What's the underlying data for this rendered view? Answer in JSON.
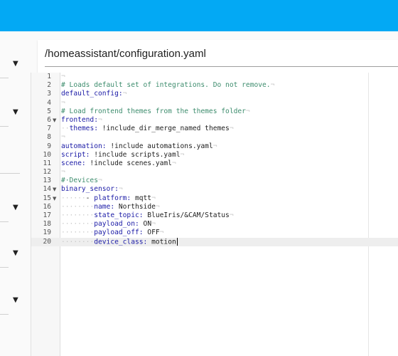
{
  "header": {
    "file_path": "/homeassistant/configuration.yaml"
  },
  "editor": {
    "lines": [
      {
        "n": "1",
        "fold": "",
        "parts": [
          {
            "t": "¬",
            "c": "ws"
          }
        ]
      },
      {
        "n": "2",
        "fold": "",
        "parts": [
          {
            "t": "# Loads default set of integrations. Do not remove.",
            "c": "comment"
          },
          {
            "t": "¬",
            "c": "ws"
          }
        ]
      },
      {
        "n": "3",
        "fold": "",
        "parts": [
          {
            "t": "default_config:",
            "c": "key"
          },
          {
            "t": "¬",
            "c": "ws"
          }
        ]
      },
      {
        "n": "4",
        "fold": "",
        "parts": [
          {
            "t": "¬",
            "c": "ws"
          }
        ]
      },
      {
        "n": "5",
        "fold": "",
        "parts": [
          {
            "t": "# Load frontend themes from the themes folder",
            "c": "comment"
          },
          {
            "t": "¬",
            "c": "ws"
          }
        ]
      },
      {
        "n": "6",
        "fold": "▼",
        "parts": [
          {
            "t": "frontend:",
            "c": "key"
          },
          {
            "t": "¬",
            "c": "ws"
          }
        ]
      },
      {
        "n": "7",
        "fold": "",
        "parts": [
          {
            "t": "··",
            "c": "ws"
          },
          {
            "t": "themes:",
            "c": "key"
          },
          {
            "t": " !include_dir_merge_named themes",
            "c": ""
          },
          {
            "t": "¬",
            "c": "ws"
          }
        ]
      },
      {
        "n": "8",
        "fold": "",
        "parts": [
          {
            "t": "¬",
            "c": "ws"
          }
        ]
      },
      {
        "n": "9",
        "fold": "",
        "parts": [
          {
            "t": "automation:",
            "c": "key"
          },
          {
            "t": " !include automations.yaml",
            "c": ""
          },
          {
            "t": "¬",
            "c": "ws"
          }
        ]
      },
      {
        "n": "10",
        "fold": "",
        "parts": [
          {
            "t": "script:",
            "c": "key"
          },
          {
            "t": " !include scripts.yaml",
            "c": ""
          },
          {
            "t": "¬",
            "c": "ws"
          }
        ]
      },
      {
        "n": "11",
        "fold": "",
        "parts": [
          {
            "t": "scene:",
            "c": "key"
          },
          {
            "t": " !include scenes.yaml",
            "c": ""
          },
          {
            "t": "¬",
            "c": "ws"
          }
        ]
      },
      {
        "n": "12",
        "fold": "",
        "parts": [
          {
            "t": "¬",
            "c": "ws"
          }
        ]
      },
      {
        "n": "13",
        "fold": "",
        "parts": [
          {
            "t": "#·Devices",
            "c": "comment"
          },
          {
            "t": "¬",
            "c": "ws"
          }
        ]
      },
      {
        "n": "14",
        "fold": "▼",
        "parts": [
          {
            "t": "binary_sensor:",
            "c": "key"
          },
          {
            "t": "¬",
            "c": "ws"
          }
        ]
      },
      {
        "n": "15",
        "fold": "▼",
        "parts": [
          {
            "t": "······",
            "c": "ws"
          },
          {
            "t": "- ",
            "c": ""
          },
          {
            "t": "platform:",
            "c": "key"
          },
          {
            "t": " mqtt",
            "c": ""
          },
          {
            "t": "¬",
            "c": "ws"
          }
        ]
      },
      {
        "n": "16",
        "fold": "",
        "parts": [
          {
            "t": "········",
            "c": "ws"
          },
          {
            "t": "name:",
            "c": "key"
          },
          {
            "t": " Northside",
            "c": ""
          },
          {
            "t": "¬",
            "c": "ws"
          }
        ]
      },
      {
        "n": "17",
        "fold": "",
        "parts": [
          {
            "t": "········",
            "c": "ws"
          },
          {
            "t": "state_topic:",
            "c": "key"
          },
          {
            "t": " BlueIris/&CAM/Status",
            "c": ""
          },
          {
            "t": "¬",
            "c": "ws"
          }
        ]
      },
      {
        "n": "18",
        "fold": "",
        "parts": [
          {
            "t": "········",
            "c": "ws"
          },
          {
            "t": "payload_on:",
            "c": "key"
          },
          {
            "t": " ON",
            "c": ""
          },
          {
            "t": "¬",
            "c": "ws"
          }
        ]
      },
      {
        "n": "19",
        "fold": "",
        "parts": [
          {
            "t": "········",
            "c": "ws"
          },
          {
            "t": "payload_off:",
            "c": "key"
          },
          {
            "t": " OFF",
            "c": ""
          },
          {
            "t": "¬",
            "c": "ws"
          }
        ]
      },
      {
        "n": "20",
        "fold": "",
        "parts": [
          {
            "t": "········",
            "c": "ws"
          },
          {
            "t": "device_class:",
            "c": "key"
          },
          {
            "t": " motion",
            "c": ""
          }
        ],
        "active": true
      }
    ]
  },
  "sidebar": {
    "items": [
      {
        "icon": "▼"
      },
      {
        "icon": "▼"
      },
      {
        "icon": "▼"
      },
      {
        "icon": "▼"
      },
      {
        "icon": "▼"
      }
    ]
  },
  "colors": {
    "topbar": "#03a9f4",
    "comment": "#3e8d6e",
    "key": "#1a1aa6"
  }
}
